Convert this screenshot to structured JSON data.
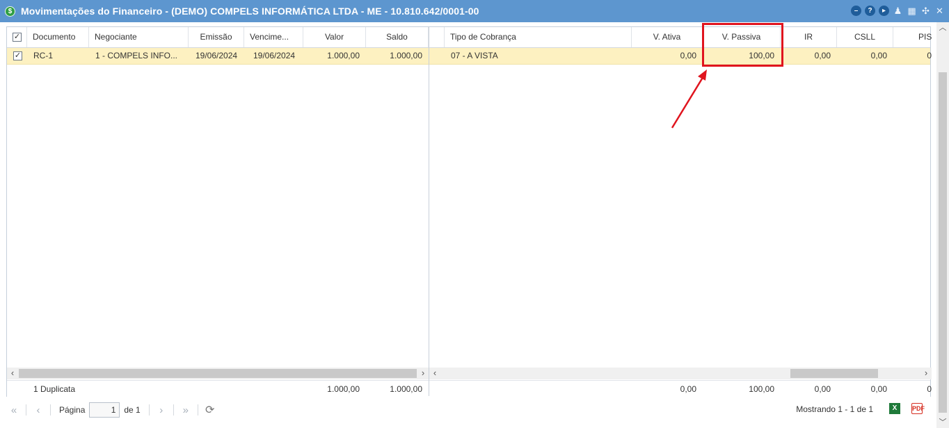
{
  "window": {
    "title": "Movimentações do Financeiro - (DEMO) COMPELS INFORMÁTICA LTDA - ME - 10.810.642/0001-00",
    "app_icon": "dollar-icon",
    "title_tools": [
      "minimize-icon",
      "help-icon",
      "play-icon",
      "user-icon",
      "calendar-icon",
      "collapse-icon",
      "close-icon"
    ]
  },
  "grid": {
    "columns_left": [
      "Documento",
      "Negociante",
      "Emissão",
      "Vencime...",
      "Valor",
      "Saldo"
    ],
    "columns_right": [
      "Tipo de Cobrança",
      "V. Ativa",
      "V. Passiva",
      "IR",
      "CSLL",
      "PIS"
    ],
    "rows": [
      {
        "documento": "RC-1",
        "negociante": "1 - COMPELS INFO...",
        "emissao": "19/06/2024",
        "vencimento": "19/06/2024",
        "valor": "1.000,00",
        "saldo": "1.000,00",
        "tipo_cobranca": "07 - A VISTA",
        "v_ativa": "0,00",
        "v_passiva": "100,00",
        "ir": "0,00",
        "csll": "0,00",
        "pis": "0"
      }
    ],
    "summary": {
      "label": "1 Duplicata",
      "valor": "1.000,00",
      "saldo": "1.000,00",
      "v_ativa": "0,00",
      "v_passiva": "100,00",
      "ir": "0,00",
      "csll": "0,00",
      "pis": "0"
    }
  },
  "pager": {
    "page_label": "Página",
    "page_value": "1",
    "of_label": "de 1",
    "showing": "Mostrando 1 - 1 de 1",
    "excel_label": "X",
    "pdf_label": "PDF"
  },
  "annotation": {
    "color": "#e0141e"
  }
}
